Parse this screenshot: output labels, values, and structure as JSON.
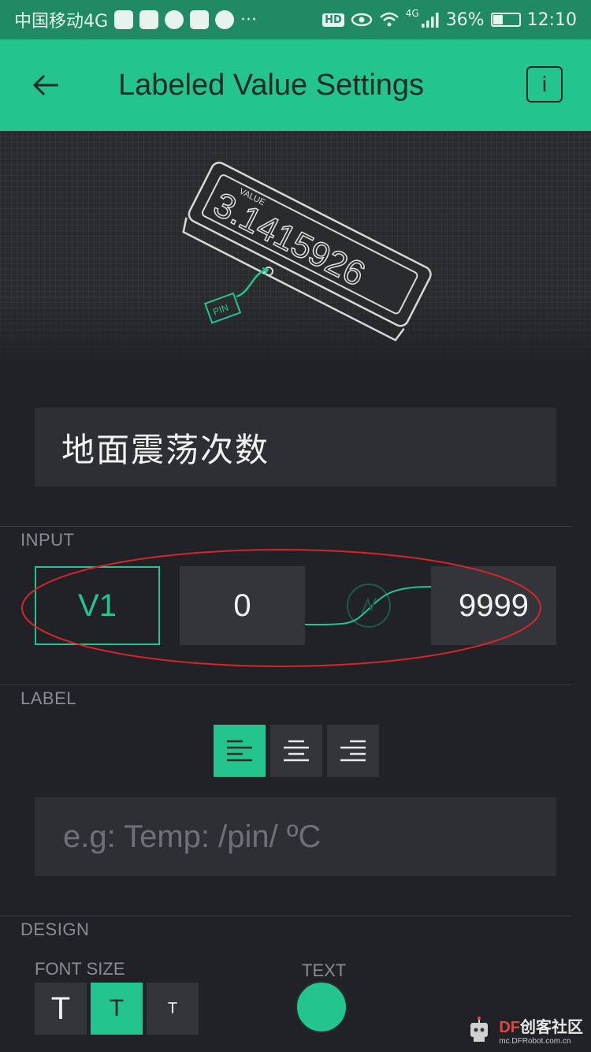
{
  "status_bar": {
    "carrier": "中国移动4G",
    "more": "···",
    "hd": "HD",
    "network": "4G",
    "battery": "36%",
    "time": "12:10"
  },
  "app_bar": {
    "title": "Labeled Value Settings",
    "info_label": "i"
  },
  "preview": {
    "value_caption": "VALUE",
    "value_text": "3.1415926",
    "pin_caption": "PIN"
  },
  "name_field": {
    "value": "地面震荡次数"
  },
  "input": {
    "section_label": "INPUT",
    "pin": "V1",
    "min": "0",
    "max": "9999"
  },
  "label": {
    "section_label": "LABEL",
    "placeholder": "e.g: Temp: /pin/ ºC",
    "alignment": "left"
  },
  "design": {
    "section_label": "DESIGN",
    "font_size_label": "FONT SIZE",
    "font_sizes": [
      "T",
      "T",
      "T"
    ],
    "selected_font_size": 1,
    "text_color_label": "TEXT",
    "text_color": "#23c48e"
  },
  "watermark": {
    "brand_prefix": "DF",
    "brand_suffix": "创客社区",
    "url": "mc.DFRobot.com.cn"
  },
  "colors": {
    "accent": "#23c48e",
    "background": "#212227",
    "field": "#34353b",
    "annotation": "#d7262b"
  }
}
